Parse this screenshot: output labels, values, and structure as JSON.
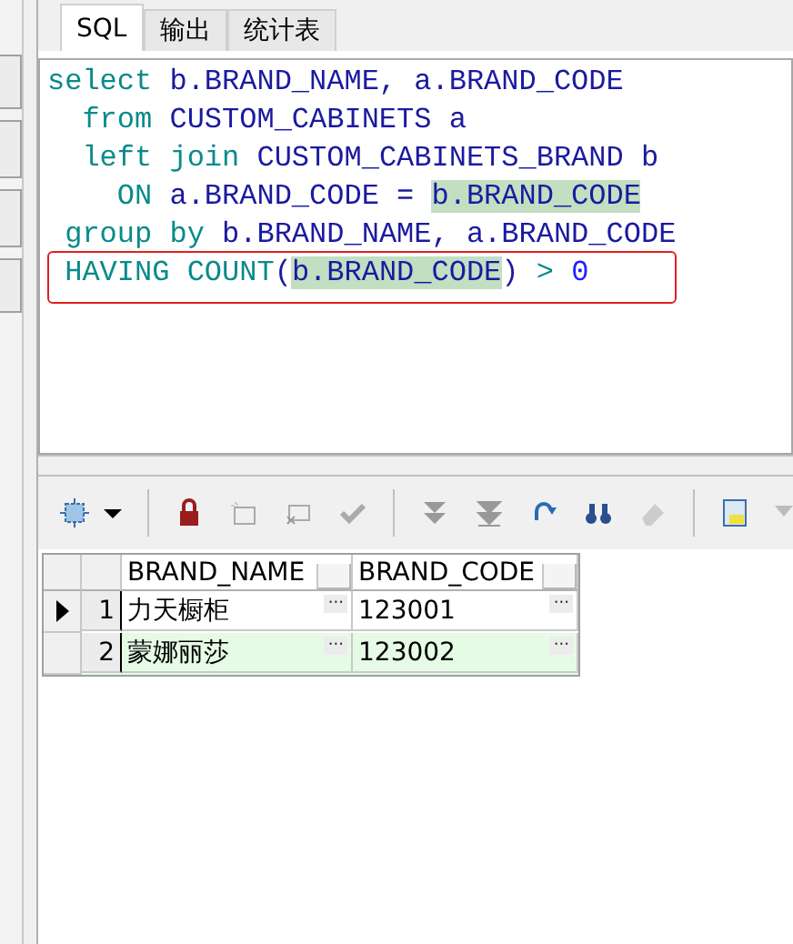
{
  "tabs": [
    {
      "label": "SQL",
      "selected": true
    },
    {
      "label": "输出",
      "selected": false
    },
    {
      "label": "统计表",
      "selected": false
    }
  ],
  "editor": {
    "lines": [
      {
        "boxed": false,
        "tokens": [
          {
            "text": "select",
            "kind": "keyword",
            "highlight": false
          },
          {
            "text": " b.BRAND_NAME, a.BRAND_CODE",
            "kind": "ident",
            "highlight": false
          }
        ]
      },
      {
        "boxed": false,
        "tokens": [
          {
            "text": "  from",
            "kind": "keyword",
            "highlight": false
          },
          {
            "text": " CUSTOM_CABINETS a",
            "kind": "ident",
            "highlight": false
          }
        ]
      },
      {
        "boxed": false,
        "tokens": [
          {
            "text": "  left join",
            "kind": "keyword",
            "highlight": false
          },
          {
            "text": " CUSTOM_CABINETS_BRAND b",
            "kind": "ident",
            "highlight": false
          }
        ]
      },
      {
        "boxed": false,
        "tokens": [
          {
            "text": "    ON",
            "kind": "keyword",
            "highlight": false
          },
          {
            "text": " a.BRAND_CODE = ",
            "kind": "ident",
            "highlight": false
          },
          {
            "text": "b.BRAND_CODE",
            "kind": "ident",
            "highlight": true
          }
        ]
      },
      {
        "boxed": false,
        "tokens": [
          {
            "text": " group by",
            "kind": "keyword",
            "highlight": false
          },
          {
            "text": " b.BRAND_NAME, a.BRAND_CODE",
            "kind": "ident",
            "highlight": false
          }
        ]
      },
      {
        "boxed": true,
        "tokens": [
          {
            "text": " HAVING COUNT",
            "kind": "keyword",
            "highlight": false
          },
          {
            "text": "(",
            "kind": "ident",
            "highlight": false
          },
          {
            "text": "b.BRAND_CODE",
            "kind": "ident",
            "highlight": true
          },
          {
            "text": ") ",
            "kind": "ident",
            "highlight": false
          },
          {
            "text": ">",
            "kind": "keyword",
            "highlight": false
          },
          {
            "text": " 0",
            "kind": "number",
            "highlight": false
          }
        ]
      }
    ]
  },
  "grid": {
    "columns": [
      "BRAND_NAME",
      "BRAND_CODE"
    ],
    "rows": [
      {
        "number": "1",
        "selected": true,
        "cells": [
          {
            "value": "力天橱柜",
            "button": "···"
          },
          {
            "value": "123001",
            "button": "···"
          }
        ]
      },
      {
        "number": "2",
        "selected": false,
        "cells": [
          {
            "value": "蒙娜丽莎",
            "button": "···"
          },
          {
            "value": "123002",
            "button": "···"
          }
        ]
      }
    ]
  }
}
